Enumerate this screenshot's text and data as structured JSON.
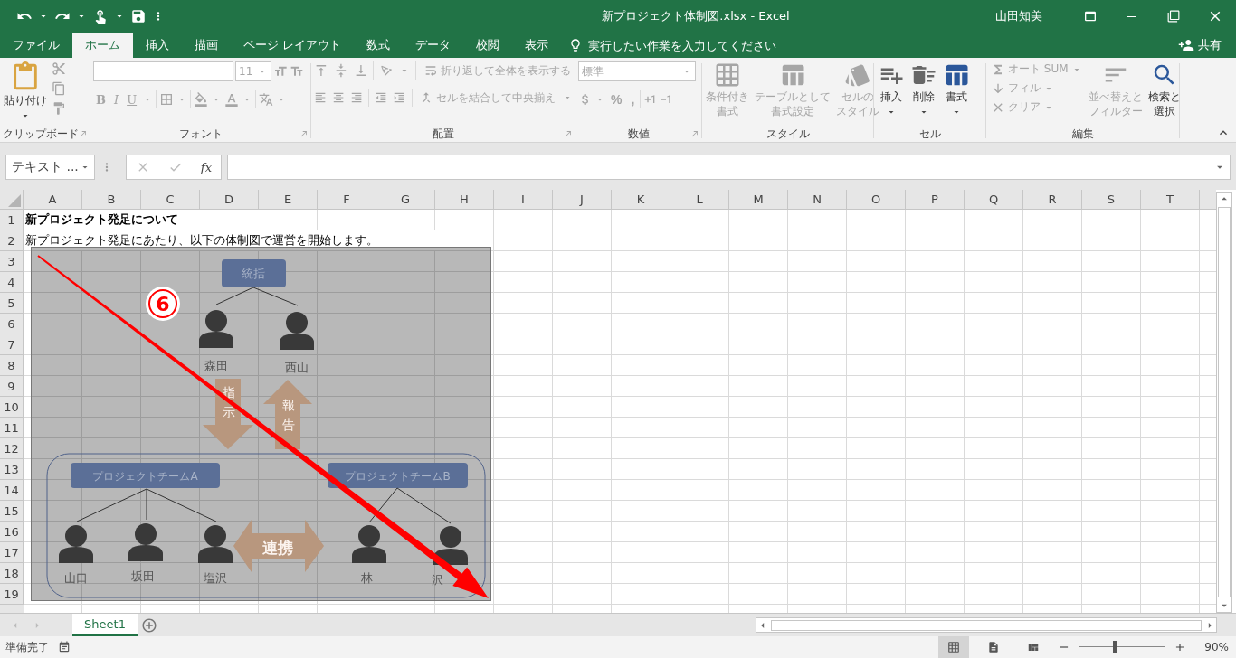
{
  "window": {
    "title": "新プロジェクト体制図.xlsx  -  Excel",
    "user": "山田知美"
  },
  "ribbon_tabs": [
    {
      "label": "ファイル",
      "selected": false
    },
    {
      "label": "ホーム",
      "selected": true
    },
    {
      "label": "挿入",
      "selected": false
    },
    {
      "label": "描画",
      "selected": false
    },
    {
      "label": "ページ レイアウト",
      "selected": false
    },
    {
      "label": "数式",
      "selected": false
    },
    {
      "label": "データ",
      "selected": false
    },
    {
      "label": "校閲",
      "selected": false
    },
    {
      "label": "表示",
      "selected": false
    }
  ],
  "tell_me": {
    "placeholder": "実行したい作業を入力してください"
  },
  "share": "共有",
  "ribbon": {
    "clipboard": {
      "label": "クリップボード",
      "paste": "貼り付け"
    },
    "font": {
      "label": "フォント",
      "font_size": "11",
      "styles": [
        {
          "kind": "bold",
          "label": "B"
        },
        {
          "kind": "italic",
          "label": "I"
        },
        {
          "kind": "underline",
          "label": "U"
        }
      ]
    },
    "alignment": {
      "label": "配置",
      "wrap": {
        "label": "折り返して全体を表示する",
        "disabled": true
      },
      "merge": {
        "label": "セルを結合して中央揃え",
        "disabled": true
      }
    },
    "number": {
      "label": "数値",
      "format": "標準",
      "symbols": [
        "%",
        ","
      ]
    },
    "styles": {
      "label": "スタイル",
      "commands": [
        {
          "kind": "conditional",
          "lines": [
            "条件付き",
            "書式"
          ],
          "disabled": true
        },
        {
          "kind": "table",
          "lines": [
            "テーブルとして",
            "書式設定"
          ],
          "disabled": true
        },
        {
          "kind": "cell",
          "lines": [
            "セルの",
            "スタイル"
          ],
          "disabled": true
        }
      ]
    },
    "cells": {
      "label": "セル",
      "commands": [
        {
          "kind": "insert",
          "label": "挿入",
          "disabled": false
        },
        {
          "kind": "delete",
          "label": "削除",
          "disabled": false
        },
        {
          "kind": "format",
          "label": "書式",
          "disabled": false
        }
      ]
    },
    "editing": {
      "label": "編集",
      "small": [
        {
          "kind": "sum",
          "label": "オート SUM",
          "disabled": true
        },
        {
          "kind": "fill",
          "label": "フィル",
          "disabled": true
        },
        {
          "kind": "clear",
          "label": "クリア",
          "disabled": true
        }
      ],
      "large": [
        {
          "kind": "sort",
          "lines": [
            "並べ替えと",
            "フィルター"
          ],
          "disabled": true
        },
        {
          "kind": "find",
          "lines": [
            "検索と",
            "選択"
          ],
          "disabled": false
        }
      ]
    }
  },
  "formula_bar": {
    "name_box": "テキスト ...",
    "fx": "fx"
  },
  "sheet": {
    "columns": [
      "A",
      "B",
      "C",
      "D",
      "E",
      "F",
      "G",
      "H",
      "I",
      "J",
      "K",
      "L",
      "M",
      "N",
      "O",
      "P",
      "Q",
      "R",
      "S",
      "T"
    ],
    "rows": [
      {
        "label": "1",
        "text": "新プロジェクト発足について",
        "bold": true
      },
      {
        "label": "2",
        "text": "新プロジェクト発足にあたり、以下の体制図で運営を開始します。",
        "bold": false
      },
      {
        "label": "3"
      },
      {
        "label": "4"
      },
      {
        "label": "5"
      },
      {
        "label": "6"
      },
      {
        "label": "7"
      },
      {
        "label": "8"
      },
      {
        "label": "9"
      },
      {
        "label": "10"
      },
      {
        "label": "11"
      },
      {
        "label": "12"
      },
      {
        "label": "13"
      },
      {
        "label": "14"
      },
      {
        "label": "15"
      },
      {
        "label": "16"
      },
      {
        "label": "17"
      },
      {
        "label": "18"
      },
      {
        "label": "19"
      }
    ]
  },
  "diagram": {
    "top": "統括",
    "leaders": [
      "森田",
      "西山"
    ],
    "instruction": "指示",
    "report": "報告",
    "link": "連携",
    "step": "6",
    "teams": [
      {
        "name": "プロジェクトチームA",
        "members": [
          "山口",
          "坂田",
          "塩沢"
        ]
      },
      {
        "name": "プロジェクトチームB",
        "members": [
          "林",
          "沢"
        ]
      }
    ]
  },
  "sheet_tabs": [
    {
      "label": "Sheet1",
      "selected": true
    }
  ],
  "status_bar": {
    "text": "準備完了",
    "views": [
      {
        "kind": "normal",
        "selected": true
      },
      {
        "kind": "page_layout",
        "selected": false
      },
      {
        "kind": "page_break",
        "selected": false
      }
    ],
    "zoom": {
      "level": 0.41,
      "reading": "90%"
    }
  }
}
